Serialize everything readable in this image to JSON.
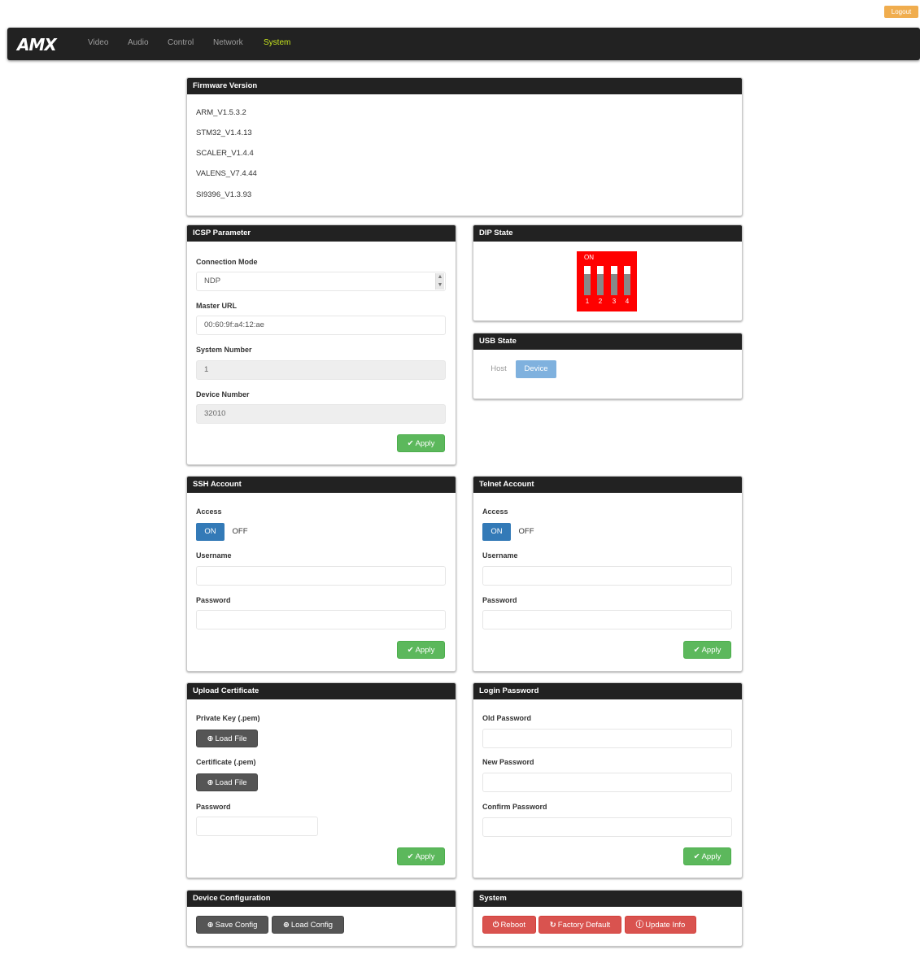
{
  "header": {
    "logout_label": "Logout",
    "logo": "AMX",
    "nav": [
      "Video",
      "Audio",
      "Control",
      "Network",
      "System"
    ],
    "active_nav": "System"
  },
  "firmware": {
    "title": "Firmware Version",
    "versions": [
      "ARM_V1.5.3.2",
      "STM32_V1.4.13",
      "SCALER_V1.4.4",
      "VALENS_V7.4.44",
      "SI9396_V1.3.93"
    ]
  },
  "icsp": {
    "title": "ICSP Parameter",
    "connection_mode_label": "Connection Mode",
    "connection_mode_value": "NDP",
    "master_url_label": "Master URL",
    "master_url_value": "00:60:9f:a4:12:ae",
    "system_number_label": "System Number",
    "system_number_value": "1",
    "device_number_label": "Device Number",
    "device_number_value": "32010",
    "apply_label": "Apply"
  },
  "dip": {
    "title": "DIP State",
    "on_label": "ON",
    "switches": [
      "1",
      "2",
      "3",
      "4"
    ],
    "color": "#ff0000"
  },
  "usb": {
    "title": "USB State",
    "host_label": "Host",
    "device_label": "Device",
    "selected": "Device"
  },
  "ssh": {
    "title": "SSH Account",
    "access_label": "Access",
    "on_label": "ON",
    "off_label": "OFF",
    "access_value": "ON",
    "username_label": "Username",
    "username_value": "",
    "password_label": "Password",
    "password_value": "",
    "apply_label": "Apply"
  },
  "telnet": {
    "title": "Telnet Account",
    "access_label": "Access",
    "on_label": "ON",
    "off_label": "OFF",
    "access_value": "ON",
    "username_label": "Username",
    "username_value": "",
    "password_label": "Password",
    "password_value": "",
    "apply_label": "Apply"
  },
  "certificate": {
    "title": "Upload Certificate",
    "private_key_label": "Private Key (.pem)",
    "certificate_label": "Certificate (.pem)",
    "load_file_label": "Load File",
    "password_label": "Password",
    "password_value": "",
    "apply_label": "Apply"
  },
  "login_password": {
    "title": "Login Password",
    "old_label": "Old Password",
    "new_label": "New Password",
    "confirm_label": "Confirm Password",
    "apply_label": "Apply"
  },
  "device_config": {
    "title": "Device Configuration",
    "save_label": "Save Config",
    "load_label": "Load Config"
  },
  "system": {
    "title": "System",
    "reboot_label": "Reboot",
    "factory_label": "Factory Default",
    "update_label": "Update Info"
  },
  "colors": {
    "navbar": "#222222",
    "active_nav": "#c7e51f",
    "primary": "#337ab7",
    "success": "#5cb85c",
    "danger": "#d9534f",
    "warning": "#f0ad4e"
  },
  "icons": {
    "apply": "check-icon",
    "load_file": "upload-icon",
    "reboot": "power-icon",
    "factory_default": "refresh-icon",
    "update_info": "info-icon"
  }
}
